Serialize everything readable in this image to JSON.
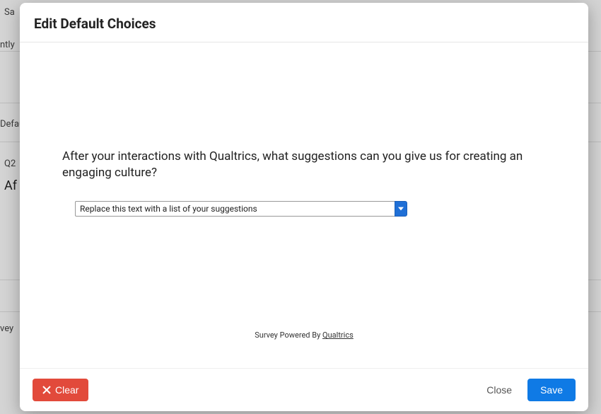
{
  "background": {
    "sa_label": "Sa",
    "ntly_label": "ntly",
    "defau_label": "Defau",
    "q_label": "Q2",
    "af_label": "Af",
    "vey_label": "vey"
  },
  "modal": {
    "title": "Edit Default Choices",
    "question": "After your interactions with Qualtrics, what suggestions can you give us for creating an engaging culture?",
    "dropdown_value": "Replace this text with a list of your suggestions",
    "powered_prefix": "Survey Powered By ",
    "powered_brand": "Qualtrics",
    "buttons": {
      "clear": "Clear",
      "close": "Close",
      "save": "Save"
    }
  }
}
